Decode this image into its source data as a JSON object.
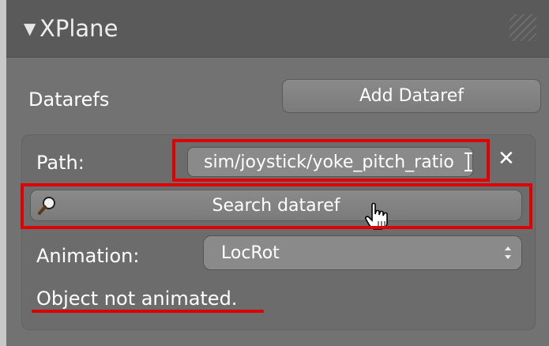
{
  "panel": {
    "title": "XPlane",
    "datarefs_label": "Datarefs",
    "add_button": "Add Dataref",
    "path_label": "Path:",
    "path_value": "sim/joystick/yoke_pitch_ratio",
    "search_button": "Search dataref",
    "animation_label": "Animation:",
    "animation_value": "LocRot",
    "status_text": "Object not animated."
  },
  "icons": {
    "collapse": "triangle-down-icon",
    "grip": "panel-grip-icon",
    "clear": "close-icon",
    "search": "magnifier-icon",
    "dropdown": "updown-chevron-icon",
    "text_cursor": "text-cursor-icon",
    "pointer": "hand-pointer-icon"
  },
  "colors": {
    "highlight": "#e00000",
    "panel": "#727272",
    "header": "#5a5a5a",
    "button": "#838383"
  }
}
